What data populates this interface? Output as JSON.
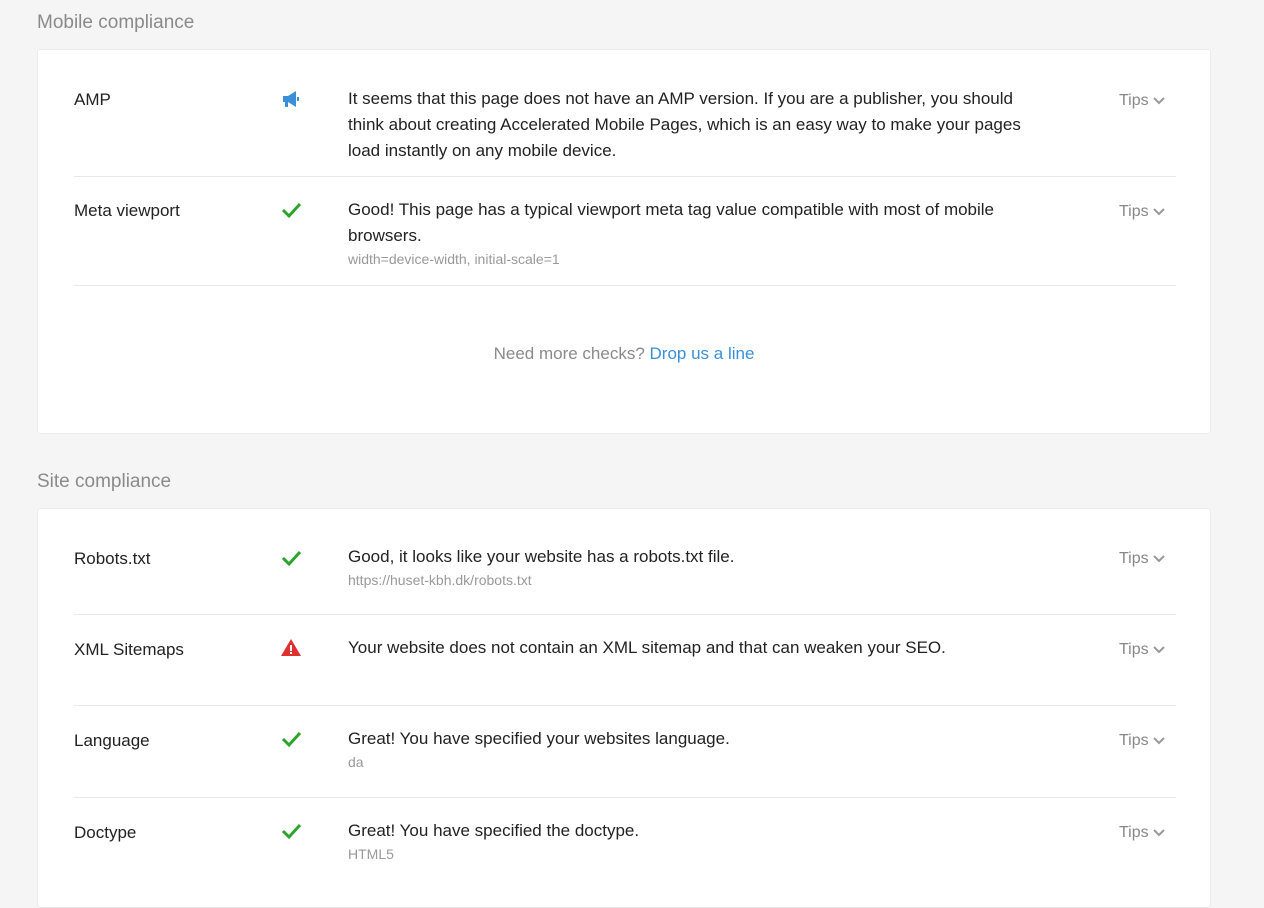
{
  "mobile": {
    "title": "Mobile compliance",
    "rows": [
      {
        "name": "AMP",
        "icon": "megaphone-icon",
        "message": "It seems that this page does not have an AMP version. If you are a publisher, you should think about creating Accelerated Mobile Pages, which is an easy way to make your pages load instantly on any mobile device.",
        "detail": "",
        "tips": "Tips"
      },
      {
        "name": "Meta viewport",
        "icon": "check-icon",
        "message": "Good! This page has a typical viewport meta tag value compatible with most of mobile browsers.",
        "detail": "width=device-width, initial-scale=1",
        "tips": "Tips"
      }
    ],
    "need_more_text": "Need more checks?",
    "need_more_link": "Drop us a line"
  },
  "site": {
    "title": "Site compliance",
    "rows": [
      {
        "name": "Robots.txt",
        "icon": "check-icon",
        "message": "Good, it looks like your website has a robots.txt file.",
        "detail": "https://huset-kbh.dk/robots.txt",
        "tips": "Tips"
      },
      {
        "name": "XML Sitemaps",
        "icon": "warning-icon",
        "message": "Your website does not contain an XML sitemap and that can weaken your SEO.",
        "detail": "",
        "tips": "Tips"
      },
      {
        "name": "Language",
        "icon": "check-icon",
        "message": "Great! You have specified your websites language.",
        "detail": "da",
        "tips": "Tips"
      },
      {
        "name": "Doctype",
        "icon": "check-icon",
        "message": "Great! You have specified the doctype.",
        "detail": "HTML5",
        "tips": "Tips"
      }
    ]
  },
  "colors": {
    "check": "#2aa52a",
    "warning": "#e03131",
    "megaphone": "#3a8fd8",
    "link": "#3a8fd8"
  }
}
